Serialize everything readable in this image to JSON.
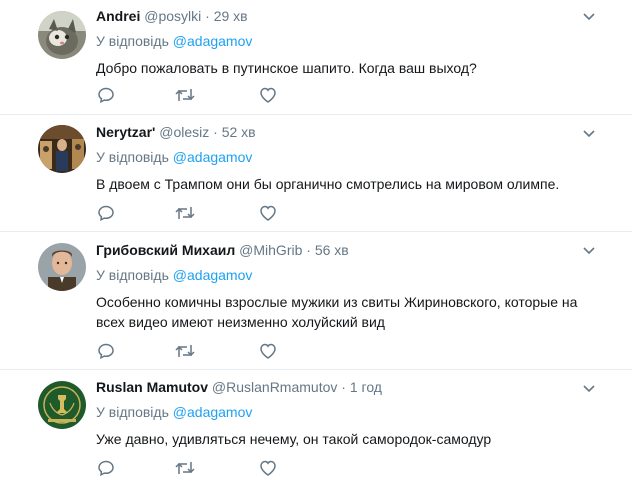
{
  "tweets": [
    {
      "name": "Andrei",
      "username": "@posylki",
      "dot": "·",
      "time": "29 хв",
      "reply_prefix": "У відповідь",
      "reply_handle": "@adagamov",
      "text": "Добро пожаловать в путинское шапито. Когда ваш выход?"
    },
    {
      "name": "Nerytzar'",
      "username": "@olesiz",
      "dot": "·",
      "time": "52 хв",
      "reply_prefix": "У відповідь",
      "reply_handle": "@adagamov",
      "text": "В двоем с Трампом они бы органично смотрелись на мировом олимпе."
    },
    {
      "name": "Грибовский Михаил",
      "username": "@MihGrib",
      "dot": "·",
      "time": "56 хв",
      "reply_prefix": "У відповідь",
      "reply_handle": "@adagamov",
      "text": "Особенно комичны взрослые мужики из свиты Жириновского, которые на всех видео имеют неизменно холуйский вид"
    },
    {
      "name": "Ruslan Mamutov",
      "username": "@RuslanRmamutov",
      "dot": "·",
      "time": "1 год",
      "reply_prefix": "У відповідь",
      "reply_handle": "@adagamov",
      "text": "Уже давно, удивляться нечему, он такой самородок-самодур"
    }
  ],
  "icons": {
    "reply": "reply-icon",
    "retweet": "retweet-icon",
    "like": "heart-icon",
    "menu": "chevron-down-icon"
  },
  "colors": {
    "text": "#14171a",
    "muted": "#657786",
    "link": "#1da1f2",
    "divider": "#e6ecf0"
  }
}
